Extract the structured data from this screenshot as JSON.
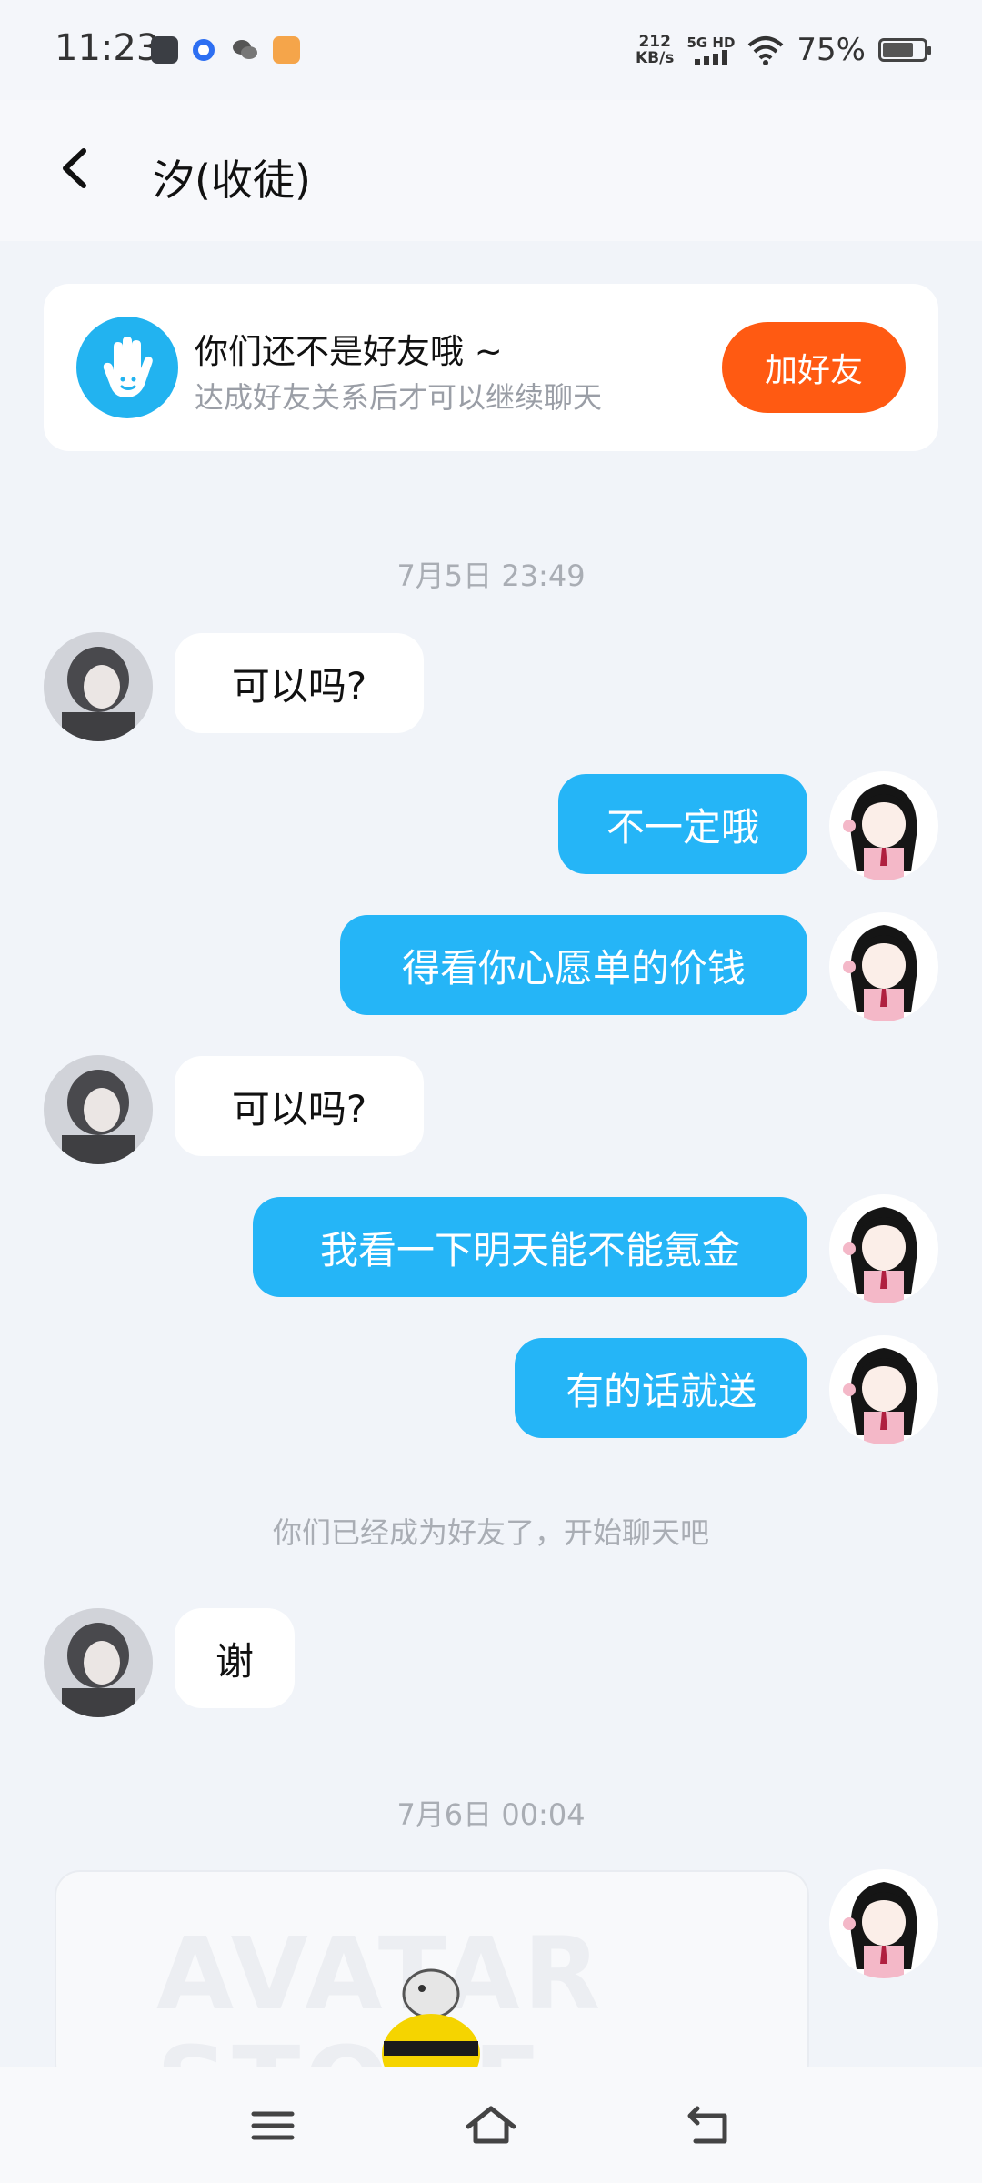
{
  "status_bar": {
    "time": "11:23",
    "net_speed_value": "212",
    "net_speed_unit": "KB/s",
    "network": "5G HD",
    "battery": "75%",
    "battery_level": 0.75
  },
  "header": {
    "title": "汐(收徒)"
  },
  "friend_banner": {
    "title": "你们还不是好友哦 ~",
    "subtitle": "达成好友关系后才可以继续聊天",
    "button": "加好友"
  },
  "chat": {
    "time_1": "7月5日 23:49",
    "msg_1": "可以吗?",
    "msg_2": "不一定哦",
    "msg_3": "得看你心愿单的价钱",
    "msg_4": "可以吗?",
    "msg_5": "我看一下明天能不能氪金",
    "msg_6": "有的话就送",
    "system_1": "你们已经成为好友了，开始聊天吧",
    "msg_7": "谢",
    "time_2": "7月6日 00:04",
    "sticker_text": "AVATAR STORE"
  },
  "colors": {
    "accent_blue": "#25b5f7",
    "add_orange": "#ff5a12",
    "background": "#f1f4f9"
  }
}
